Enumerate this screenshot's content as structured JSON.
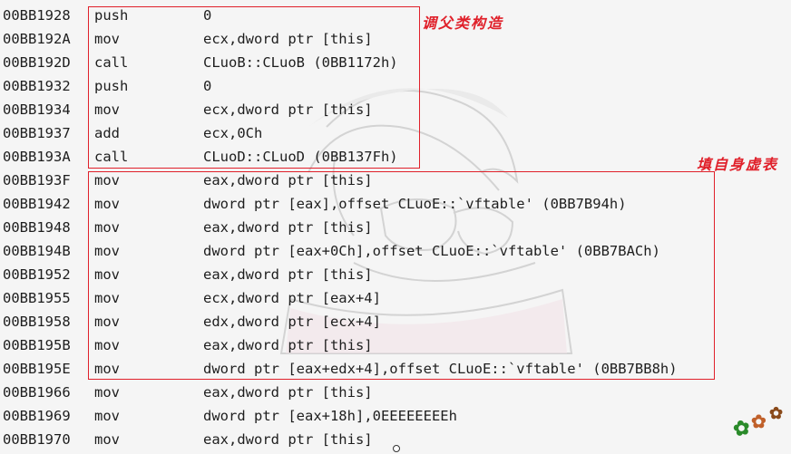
{
  "disassembly": {
    "rows": [
      {
        "address": "00BB1928",
        "mnemonic": "push",
        "operands": "0"
      },
      {
        "address": "00BB192A",
        "mnemonic": "mov",
        "operands": "ecx,dword ptr [this]"
      },
      {
        "address": "00BB192D",
        "mnemonic": "call",
        "operands": "CLuoB::CLuoB (0BB1172h)"
      },
      {
        "address": "00BB1932",
        "mnemonic": "push",
        "operands": "0"
      },
      {
        "address": "00BB1934",
        "mnemonic": "mov",
        "operands": "ecx,dword ptr [this]"
      },
      {
        "address": "00BB1937",
        "mnemonic": "add",
        "operands": "ecx,0Ch"
      },
      {
        "address": "00BB193A",
        "mnemonic": "call",
        "operands": "CLuoD::CLuoD (0BB137Fh)"
      },
      {
        "address": "00BB193F",
        "mnemonic": "mov",
        "operands": "eax,dword ptr [this]"
      },
      {
        "address": "00BB1942",
        "mnemonic": "mov",
        "operands": "dword ptr [eax],offset CLuoE::`vftable' (0BB7B94h)"
      },
      {
        "address": "00BB1948",
        "mnemonic": "mov",
        "operands": "eax,dword ptr [this]"
      },
      {
        "address": "00BB194B",
        "mnemonic": "mov",
        "operands": "dword ptr [eax+0Ch],offset CLuoE::`vftable' (0BB7BACh)"
      },
      {
        "address": "00BB1952",
        "mnemonic": "mov",
        "operands": "eax,dword ptr [this]"
      },
      {
        "address": "00BB1955",
        "mnemonic": "mov",
        "operands": "ecx,dword ptr [eax+4]"
      },
      {
        "address": "00BB1958",
        "mnemonic": "mov",
        "operands": "edx,dword ptr [ecx+4]"
      },
      {
        "address": "00BB195B",
        "mnemonic": "mov",
        "operands": "eax,dword ptr [this]"
      },
      {
        "address": "00BB195E",
        "mnemonic": "mov",
        "operands": "dword ptr [eax+edx+4],offset CLuoE::`vftable' (0BB7BB8h)"
      },
      {
        "address": "00BB1966",
        "mnemonic": "mov",
        "operands": "eax,dword ptr [this]"
      },
      {
        "address": "00BB1969",
        "mnemonic": "mov",
        "operands": "dword ptr [eax+18h],0EEEEEEEEh"
      },
      {
        "address": "00BB1970",
        "mnemonic": "mov",
        "operands": "eax,dword ptr [this]"
      }
    ]
  },
  "annotations": {
    "call_parent_ctor": "调父类构造",
    "fill_vtable": "填自身虚表"
  },
  "colors": {
    "annotation": "#e0202a",
    "text": "#1e1e1e",
    "background": "#f5f5f5"
  }
}
